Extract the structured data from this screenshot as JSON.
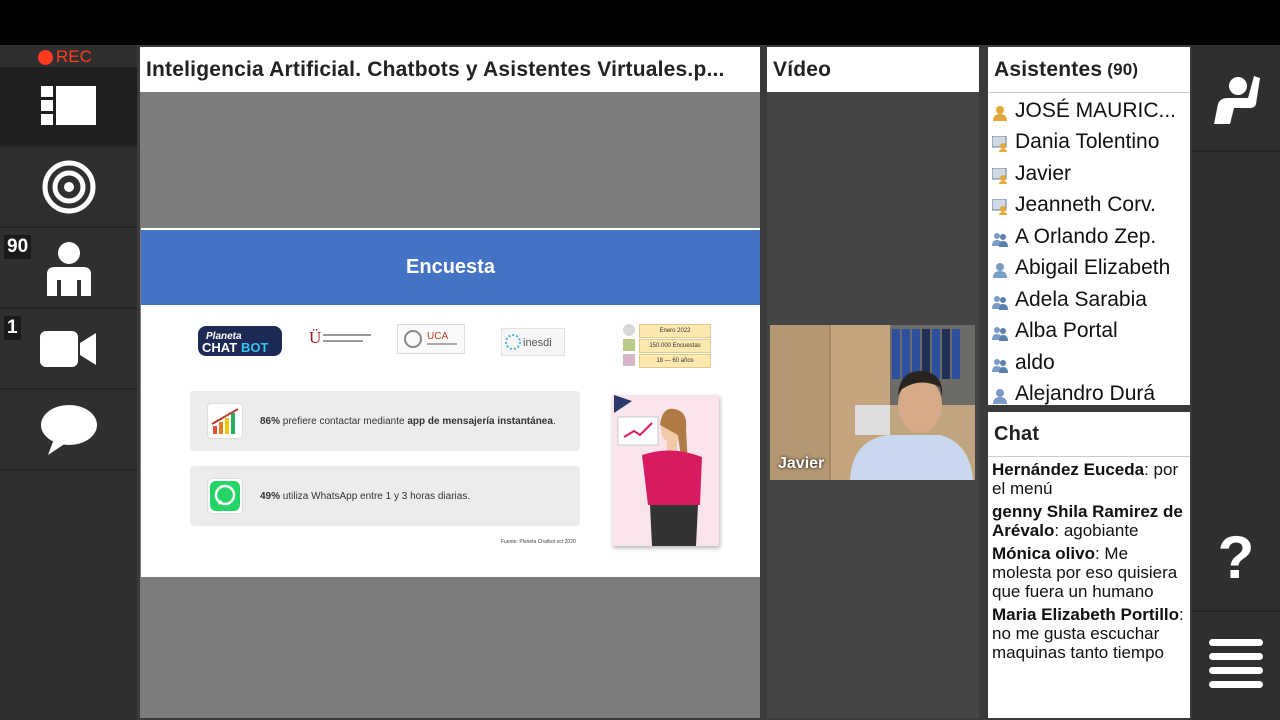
{
  "recording": {
    "label": "REC"
  },
  "left_nav": {
    "participants_count": "90",
    "cameras_count": "1"
  },
  "presentation": {
    "title": "Inteligencia Artificial. Chatbots y Asistentes Virtuales.p...",
    "slide": {
      "heading": "Encuesta",
      "logos": [
        "Planeta CHATBOT",
        "Universidad Rey Juan Carlos",
        "UCA",
        "inesdi"
      ],
      "stats_small": [
        "Enero 2022",
        "150.000 Encuestas",
        "18 — 60 años"
      ],
      "fact_1_bold": "86%",
      "fact_1_text": " prefiere contactar mediante ",
      "fact_1_bold2": "app de mensajería instantánea",
      "fact_1_end": ".",
      "fact_2_bold": "49%",
      "fact_2_text": " utiliza WhatsApp entre 1 y 3 horas diarias.",
      "source": "Fuente: Planeta Chatbot oct 2020"
    }
  },
  "video": {
    "title": "Vídeo",
    "speaker_name": "Javier"
  },
  "attendees": {
    "title": "Asistentes",
    "count": "(90)",
    "list": [
      "JOSÉ MAURIC...",
      "Dania Tolentino",
      "Javier",
      "Jeanneth Corv.",
      "A Orlando Zep.",
      "Abigail Elizabeth",
      "Adela Sarabia",
      "Alba Portal",
      "aldo",
      "Alejandro Durá"
    ]
  },
  "chat": {
    "title": "Chat",
    "messages": [
      {
        "author": "Hernández Euceda",
        "text": ": por el menú"
      },
      {
        "author": "genny Shila Ramirez de Arévalo",
        "text": ": agobiante"
      },
      {
        "author": "Mónica olivo",
        "text": ": Me molesta por eso quisiera que fuera un humano"
      },
      {
        "author": "Maria Elizabeth Portillo",
        "text": ": no me gusta escuchar maquinas tanto tiempo"
      }
    ]
  },
  "colors": {
    "slide_header": "#4472c4",
    "rec": "#ff3b1f",
    "panel_bg": "#4a4a4a",
    "sidebar_bg": "#2f2f2f"
  }
}
